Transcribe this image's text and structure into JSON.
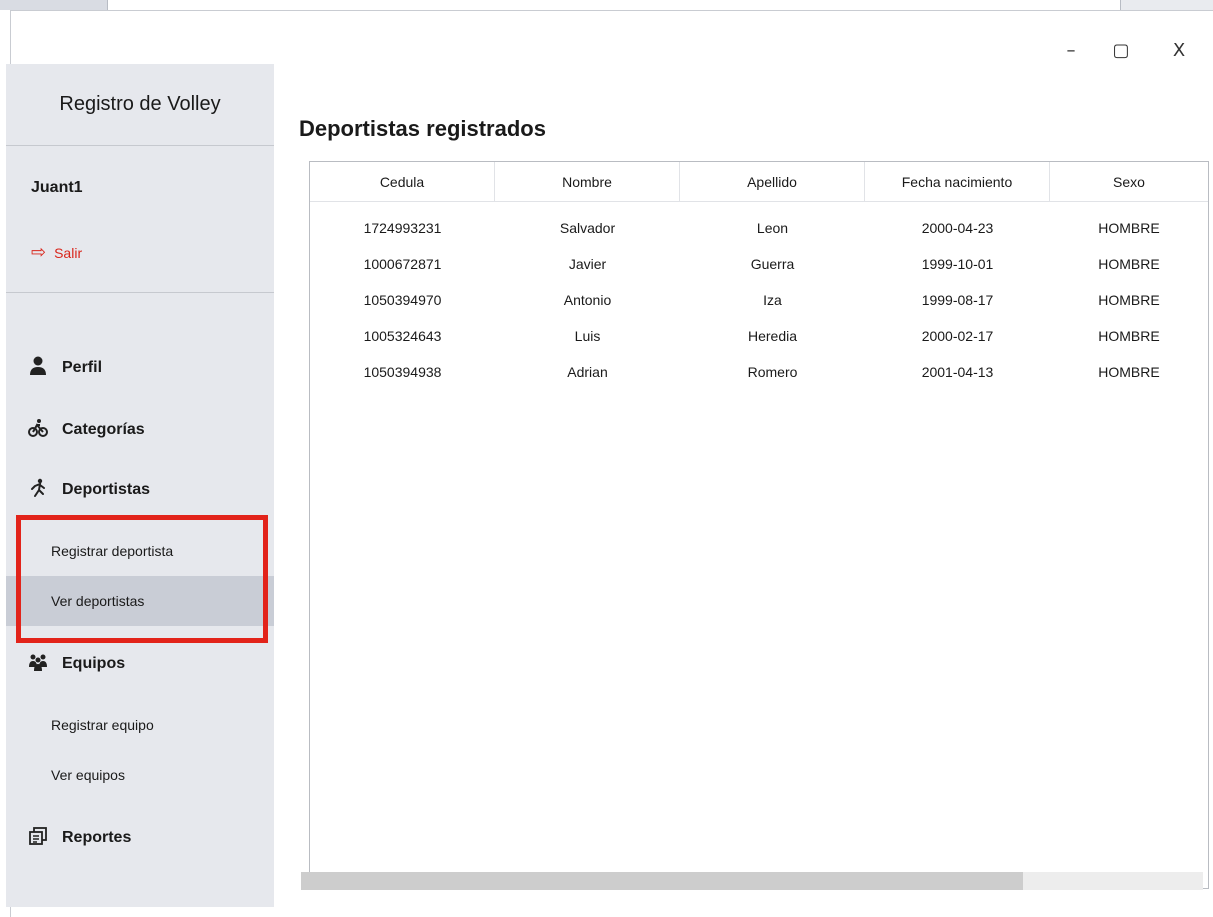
{
  "window": {
    "minimize_glyph": "–",
    "maximize_glyph": "▢",
    "close_glyph": "X"
  },
  "sidebar": {
    "app_title": "Registro de Volley",
    "username": "Juant1",
    "logout_label": "Salir",
    "nav": {
      "perfil": "Perfil",
      "categorias": "Categorías",
      "deportistas": "Deportistas",
      "registrar_deportista": "Registrar deportista",
      "ver_deportistas": "Ver deportistas",
      "equipos": "Equipos",
      "registrar_equipo": "Registrar equipo",
      "ver_equipos": "Ver equipos",
      "reportes": "Reportes"
    },
    "icons": {
      "logout": "logout-icon",
      "perfil": "user-icon",
      "categorias": "bicycle-icon",
      "deportistas": "running-person-icon",
      "equipos": "team-icon",
      "reportes": "report-icon"
    },
    "active_item": "ver_deportistas"
  },
  "main": {
    "title": "Deportistas registrados",
    "table": {
      "columns": [
        "Cedula",
        "Nombre",
        "Apellido",
        "Fecha nacimiento",
        "Sexo"
      ],
      "rows": [
        [
          "1724993231",
          "Salvador",
          "Leon",
          "2000-04-23",
          "HOMBRE"
        ],
        [
          "1000672871",
          "Javier",
          "Guerra",
          "1999-10-01",
          "HOMBRE"
        ],
        [
          "1050394970",
          "Antonio",
          "Iza",
          "1999-08-17",
          "HOMBRE"
        ],
        [
          "1005324643",
          "Luis",
          "Heredia",
          "2000-02-17",
          "HOMBRE"
        ],
        [
          "1050394938",
          "Adrian",
          "Romero",
          "2001-04-13",
          "HOMBRE"
        ]
      ]
    }
  },
  "colors": {
    "sidebar_bg": "#e6e8ed",
    "active_item_bg": "#c9cdd6",
    "highlight_red": "#e2231a",
    "logout_red": "#d9261c"
  }
}
